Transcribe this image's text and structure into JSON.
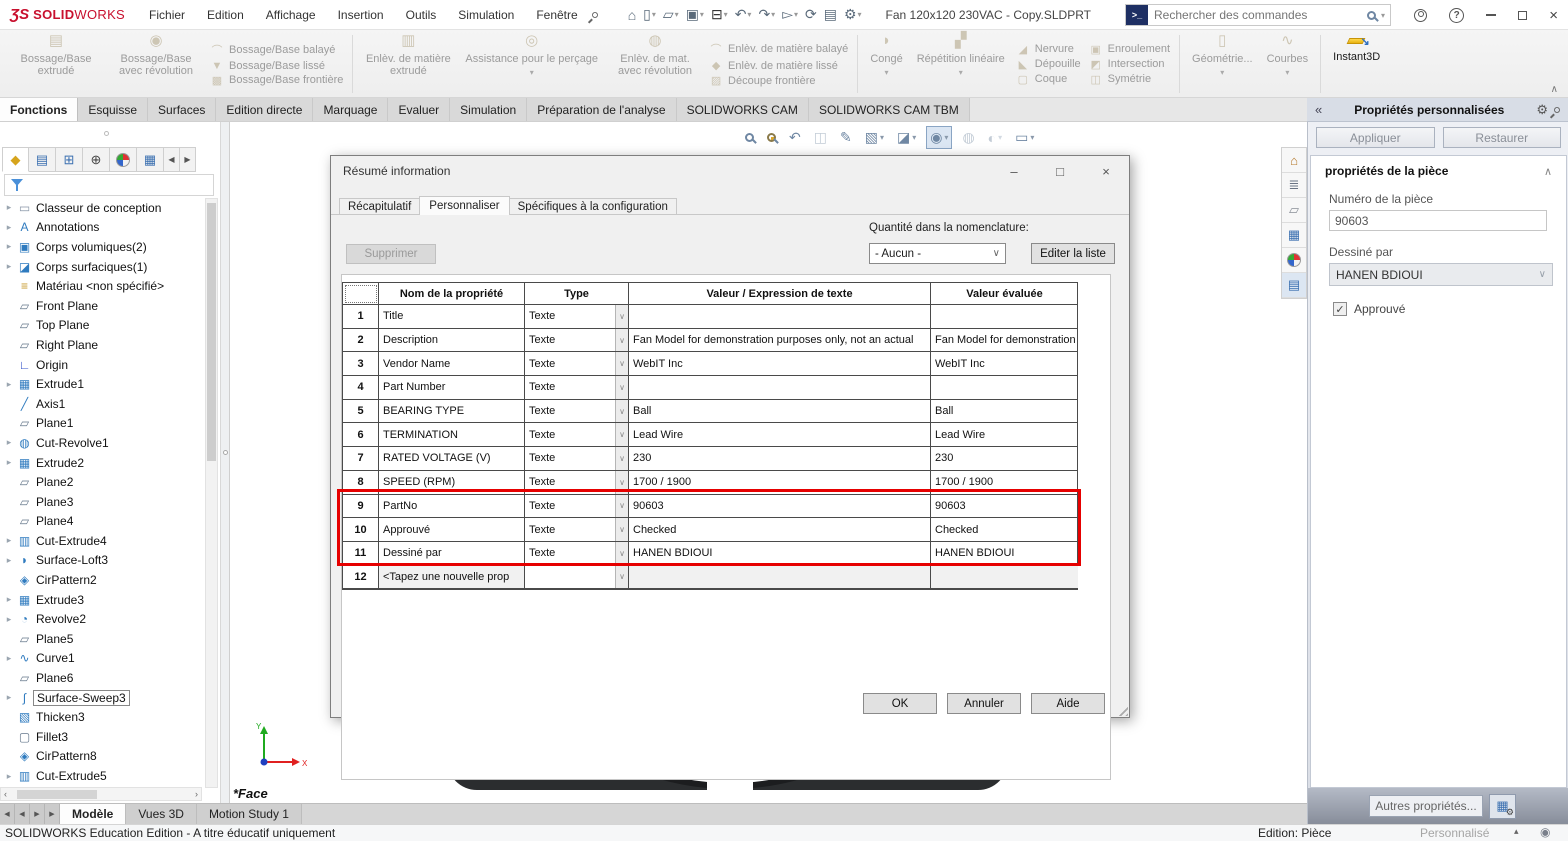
{
  "icons": {
    "home": "⌂",
    "new_doc": "▯",
    "open_doc": "▱",
    "save_doc": "▣",
    "print_doc": "⊟",
    "undo": "↶",
    "redo": "↷",
    "select_cursor": "▻",
    "rebuild": "⟳",
    "doc_props": "▤",
    "options_gear": "⚙",
    "dropdown": "▾",
    "small_chevron": "∨",
    "chevron_up": "∧",
    "chevrons_left": "«",
    "expand_arrow": "▸",
    "check": "✓",
    "caret_up": "▴",
    "tri_left": "◀",
    "tri_right": "▶",
    "prev_view": "↶",
    "section_view": "◫",
    "sketch_tool": "✎",
    "view_orientation": "▧",
    "display_style": "◪",
    "eye": "◉",
    "edit_appearance": "◍",
    "apply_scene": "◐",
    "view_settings": "▭",
    "terminal": ">_",
    "library": "≣",
    "folder": "▱",
    "view_palette": "▦",
    "custom_props": "▤",
    "feature_mgr": "◆",
    "prop_mgr": "▤",
    "config_mgr": "⊞",
    "dimxpert": "⊕",
    "globe": "◉",
    "more_props": "▦",
    "gear_small": "⚙",
    "min": "–",
    "close": "×",
    "max": "□",
    "help": "?"
  },
  "titlebar": {
    "logo_mark": "ƷS",
    "logo_bold": "SOLID",
    "logo_light": "WORKS",
    "menus": [
      "Fichier",
      "Edition",
      "Affichage",
      "Insertion",
      "Outils",
      "Simulation",
      "Fenêtre"
    ],
    "document_title": "Fan 120x120 230VAC - Copy.SLDPRT",
    "search_placeholder": "Rechercher des commandes"
  },
  "command_tabs": [
    {
      "label": "Fonctions",
      "state": "active"
    },
    {
      "label": "Esquisse",
      "state": ""
    },
    {
      "label": "Surfaces",
      "state": ""
    },
    {
      "label": "Edition directe",
      "state": ""
    },
    {
      "label": "Marquage",
      "state": ""
    },
    {
      "label": "Evaluer",
      "state": ""
    },
    {
      "label": "Simulation",
      "state": ""
    },
    {
      "label": "Préparation de l'analyse",
      "state": ""
    },
    {
      "label": "SOLIDWORKS CAM",
      "state": ""
    },
    {
      "label": "SOLIDWORKS CAM TBM",
      "state": ""
    }
  ],
  "ribbon": {
    "buttons": [
      {
        "label": "Bossage/Base extrudé",
        "glyph": "▤",
        "dd": ""
      },
      {
        "label": "Bossage/Base avec révolution",
        "glyph": "◉",
        "dd": ""
      },
      {
        "label": "Bossage/Base balayé",
        "glyph": "⌒",
        "dd": ""
      },
      {
        "label": "Bossage/Base lissé",
        "glyph": "▼",
        "dd": ""
      },
      {
        "label": "Bossage/Base frontière",
        "glyph": "▩",
        "dd": ""
      },
      {
        "label": "Enlèv. de matière extrudé",
        "glyph": "▥",
        "dd": ""
      },
      {
        "label": "Assistance pour le perçage",
        "glyph": "◎",
        "dd": "▾"
      },
      {
        "label": "Enlèv. de mat. avec révolution",
        "glyph": "◍",
        "dd": ""
      },
      {
        "label": "Enlèv. de matière balayé",
        "glyph": "⌒",
        "dd": ""
      },
      {
        "label": "Enlèv. de matière lissé",
        "glyph": "◆",
        "dd": ""
      },
      {
        "label": "Découpe frontière",
        "glyph": "▨",
        "dd": ""
      },
      {
        "label": "Congé",
        "glyph": "◗",
        "dd": "▾"
      },
      {
        "label": "Répétition linéaire",
        "glyph": "▞",
        "dd": "▾"
      },
      {
        "label": "Nervure",
        "glyph": "◢",
        "dd": ""
      },
      {
        "label": "Dépouille",
        "glyph": "◣",
        "dd": ""
      },
      {
        "label": "Coque",
        "glyph": "▢",
        "dd": ""
      },
      {
        "label": "Enroulement",
        "glyph": "▣",
        "dd": ""
      },
      {
        "label": "Intersection",
        "glyph": "◩",
        "dd": ""
      },
      {
        "label": "Symétrie",
        "glyph": "◫",
        "dd": ""
      },
      {
        "label": "Géométrie...",
        "glyph": "▯",
        "dd": "▾"
      },
      {
        "label": "Courbes",
        "glyph": "∿",
        "dd": "▾"
      },
      {
        "label": "Instant3D",
        "glyph": "↘",
        "dd": "",
        "state": "enabled"
      }
    ]
  },
  "feature_tree": {
    "items": [
      {
        "a": "▸",
        "g": "▭",
        "c": "#8a97a8",
        "t": "Classeur de conception",
        "s": ""
      },
      {
        "a": "▸",
        "g": "A",
        "c": "#2f7bbf",
        "t": "Annotations",
        "s": ""
      },
      {
        "a": "▸",
        "g": "▣",
        "c": "#2f7bbf",
        "t": "Corps volumiques(2)",
        "s": ""
      },
      {
        "a": "▸",
        "g": "◪",
        "c": "#2f7bbf",
        "t": "Corps surfaciques(1)",
        "s": ""
      },
      {
        "a": "",
        "g": "≡",
        "c": "#c79a2e",
        "t": "Matériau <non spécifié>",
        "s": ""
      },
      {
        "a": "",
        "g": "▱",
        "c": "#66788c",
        "t": "Front Plane",
        "s": ""
      },
      {
        "a": "",
        "g": "▱",
        "c": "#66788c",
        "t": "Top Plane",
        "s": ""
      },
      {
        "a": "",
        "g": "▱",
        "c": "#66788c",
        "t": "Right Plane",
        "s": ""
      },
      {
        "a": "",
        "g": "∟",
        "c": "#3050c8",
        "t": "Origin",
        "s": ""
      },
      {
        "a": "▸",
        "g": "▦",
        "c": "#2f7bbf",
        "t": "Extrude1",
        "s": ""
      },
      {
        "a": "",
        "g": "╱",
        "c": "#2f7bbf",
        "t": "Axis1",
        "s": ""
      },
      {
        "a": "",
        "g": "▱",
        "c": "#66788c",
        "t": "Plane1",
        "s": ""
      },
      {
        "a": "▸",
        "g": "◍",
        "c": "#2f7bbf",
        "t": "Cut-Revolve1",
        "s": ""
      },
      {
        "a": "▸",
        "g": "▦",
        "c": "#2f7bbf",
        "t": "Extrude2",
        "s": ""
      },
      {
        "a": "",
        "g": "▱",
        "c": "#66788c",
        "t": "Plane2",
        "s": ""
      },
      {
        "a": "",
        "g": "▱",
        "c": "#66788c",
        "t": "Plane3",
        "s": ""
      },
      {
        "a": "",
        "g": "▱",
        "c": "#66788c",
        "t": "Plane4",
        "s": ""
      },
      {
        "a": "▸",
        "g": "▥",
        "c": "#2f7bbf",
        "t": "Cut-Extrude4",
        "s": ""
      },
      {
        "a": "▸",
        "g": "◗",
        "c": "#2f7bbf",
        "t": "Surface-Loft3",
        "s": ""
      },
      {
        "a": "",
        "g": "◈",
        "c": "#2f7bbf",
        "t": "CirPattern2",
        "s": ""
      },
      {
        "a": "▸",
        "g": "▦",
        "c": "#2f7bbf",
        "t": "Extrude3",
        "s": ""
      },
      {
        "a": "▸",
        "g": "◔",
        "c": "#2f7bbf",
        "t": "Revolve2",
        "s": ""
      },
      {
        "a": "",
        "g": "▱",
        "c": "#66788c",
        "t": "Plane5",
        "s": ""
      },
      {
        "a": "▸",
        "g": "∿",
        "c": "#2f7bbf",
        "t": "Curve1",
        "s": ""
      },
      {
        "a": "",
        "g": "▱",
        "c": "#66788c",
        "t": "Plane6",
        "s": ""
      },
      {
        "a": "▸",
        "g": "∫",
        "c": "#2f7bbf",
        "t": "Surface-Sweep3",
        "s": "boxed"
      },
      {
        "a": "",
        "g": "▧",
        "c": "#2f7bbf",
        "t": "Thicken3",
        "s": ""
      },
      {
        "a": "",
        "g": "▢",
        "c": "#66788c",
        "t": "Fillet3",
        "s": ""
      },
      {
        "a": "",
        "g": "◈",
        "c": "#2f7bbf",
        "t": "CirPattern8",
        "s": ""
      },
      {
        "a": "▸",
        "g": "▥",
        "c": "#2f7bbf",
        "t": "Cut-Extrude5",
        "s": ""
      }
    ]
  },
  "viewport": {
    "annotation": "*Face",
    "triad": {
      "x_label": "X",
      "y_label": "Y"
    }
  },
  "dialog": {
    "title": "Résumé information",
    "tabs": [
      {
        "label": "Récapitulatif",
        "state": ""
      },
      {
        "label": "Personnaliser",
        "state": "active"
      },
      {
        "label": "Spécifiques à la configuration",
        "state": ""
      }
    ],
    "delete_button": "Supprimer",
    "bom_quantity_label": "Quantité dans la nomenclature:",
    "bom_quantity_value": "- Aucun -",
    "edit_list_button": "Editer la liste",
    "table": {
      "headers": [
        "Nom de la propriété",
        "Type",
        "Valeur / Expression de texte",
        "Valeur évaluée"
      ],
      "rows": [
        {
          "num": "1",
          "name": "Title",
          "type": "Texte",
          "value": "",
          "evaluated": "",
          "state": ""
        },
        {
          "num": "2",
          "name": "Description",
          "type": "Texte",
          "value": "Fan Model for demonstration purposes only, not an actual",
          "evaluated": "Fan Model for demonstration",
          "state": ""
        },
        {
          "num": "3",
          "name": "Vendor Name",
          "type": "Texte",
          "value": "WebIT Inc",
          "evaluated": "WebIT Inc",
          "state": ""
        },
        {
          "num": "4",
          "name": "Part Number",
          "type": "Texte",
          "value": "",
          "evaluated": "",
          "state": ""
        },
        {
          "num": "5",
          "name": "BEARING TYPE",
          "type": "Texte",
          "value": "Ball",
          "evaluated": "Ball",
          "state": ""
        },
        {
          "num": "6",
          "name": "TERMINATION",
          "type": "Texte",
          "value": "Lead Wire",
          "evaluated": "Lead Wire",
          "state": ""
        },
        {
          "num": "7",
          "name": "RATED VOLTAGE (V)",
          "type": "Texte",
          "value": "230",
          "evaluated": "230",
          "state": ""
        },
        {
          "num": "8",
          "name": "SPEED (RPM)",
          "type": "Texte",
          "value": "1700 / 1900",
          "evaluated": "1700 / 1900",
          "state": ""
        },
        {
          "num": "9",
          "name": "PartNo",
          "type": "Texte",
          "value": "90603",
          "evaluated": "90603",
          "state": ""
        },
        {
          "num": "10",
          "name": "Approuvé",
          "type": "Texte",
          "value": "Checked",
          "evaluated": "Checked",
          "state": ""
        },
        {
          "num": "11",
          "name": "Dessiné par",
          "type": "Texte",
          "value": "HANEN BDIOUI",
          "evaluated": "HANEN BDIOUI",
          "state": ""
        },
        {
          "num": "12",
          "name": "<Tapez une nouvelle prop",
          "type": "",
          "value": "",
          "evaluated": "",
          "state": "new"
        }
      ]
    },
    "ok_button": "OK",
    "cancel_button": "Annuler",
    "help_button": "Aide"
  },
  "right_panel": {
    "title": "Propriétés personnalisées",
    "apply_button": "Appliquer",
    "restore_button": "Restaurer",
    "section_title": "propriétés de la pièce",
    "part_number_label": "Numéro de la pièce",
    "part_number_value": "90603",
    "designed_by_label": "Dessiné par",
    "designed_by_value": "HANEN BDIOUI",
    "approved_label": "Approuvé",
    "more_properties_button": "Autres propriétés..."
  },
  "bottom": {
    "model_tabs": [
      {
        "label": "Modèle",
        "state": "active"
      },
      {
        "label": "Vues 3D",
        "state": ""
      },
      {
        "label": "Motion Study 1",
        "state": ""
      }
    ]
  },
  "statusbar": {
    "left_text": "SOLIDWORKS Education Edition - A titre éducatif uniquement",
    "edit_mode": "Edition: Pièce",
    "customized": "Personnalisé"
  }
}
